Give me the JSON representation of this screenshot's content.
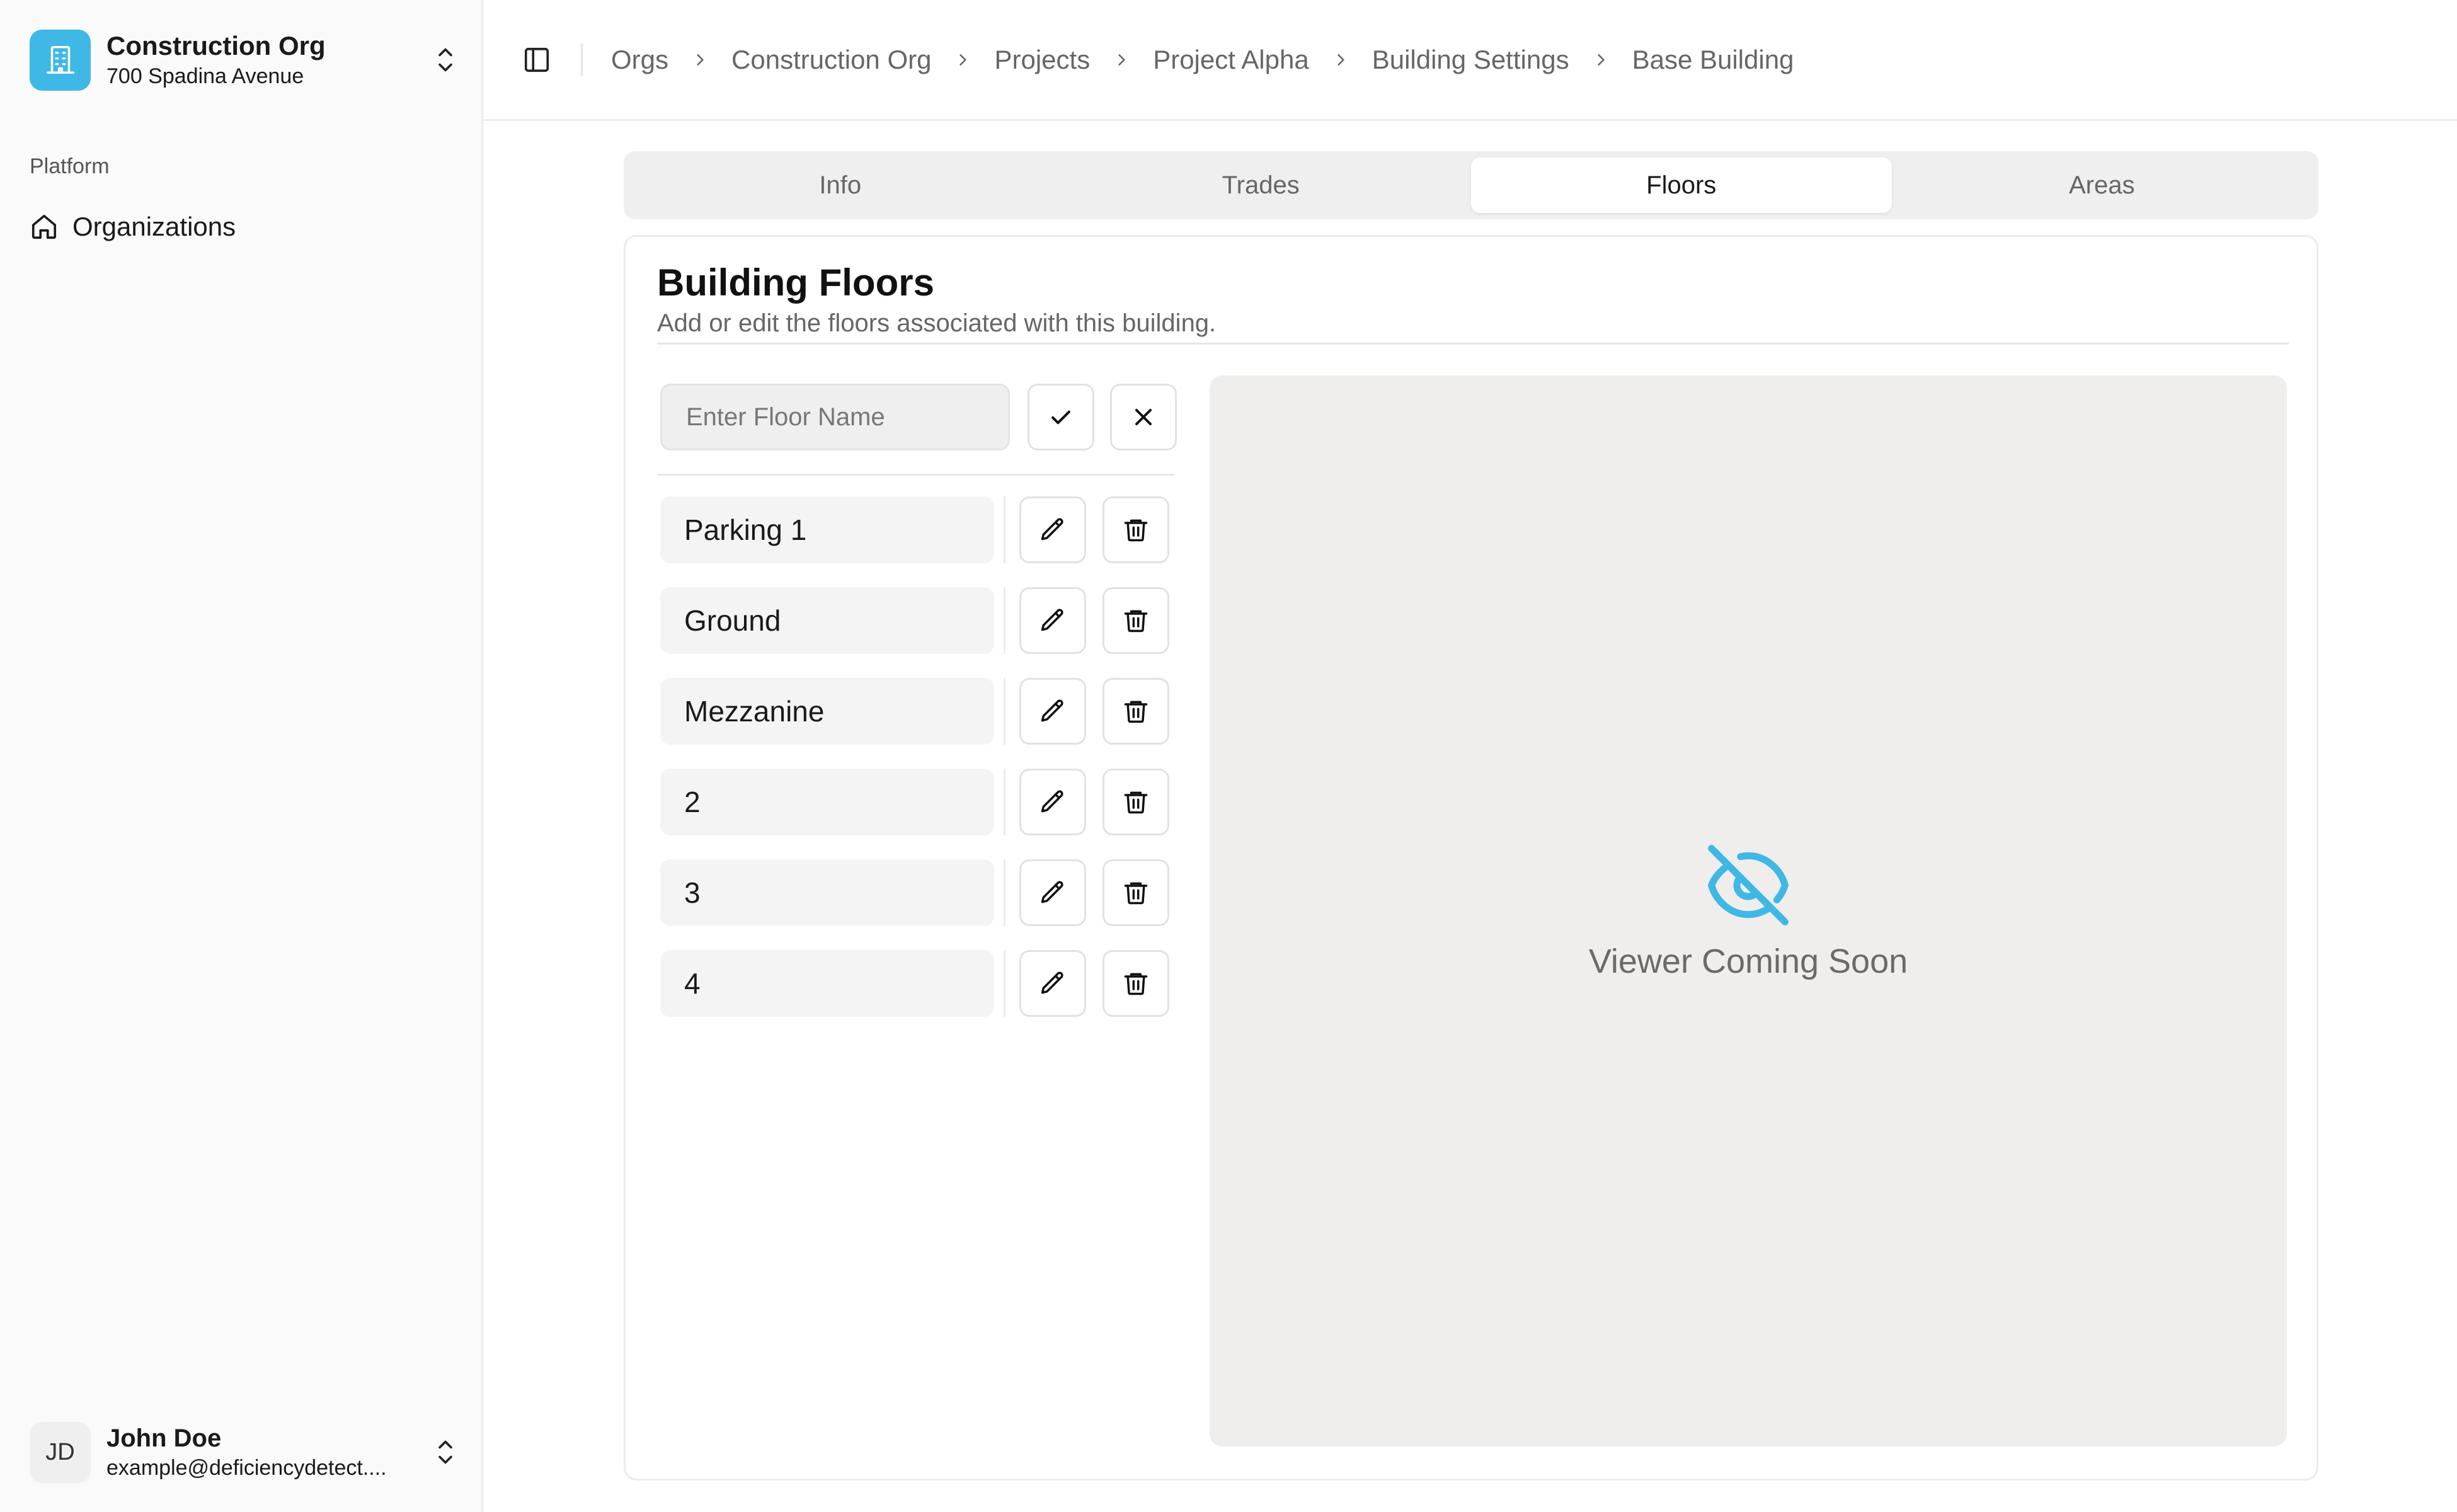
{
  "org": {
    "name": "Construction Org",
    "address": "700 Spadina Avenue",
    "accent": "#3fb8e6"
  },
  "sidebar": {
    "section_label": "Platform",
    "items": [
      {
        "label": "Organizations",
        "icon": "home-icon"
      }
    ]
  },
  "user": {
    "initials": "JD",
    "name": "John Doe",
    "email": "example@deficiencydetect...."
  },
  "breadcrumb": [
    "Orgs",
    "Construction Org",
    "Projects",
    "Project Alpha",
    "Building Settings",
    "Base Building"
  ],
  "tabs": [
    {
      "label": "Info",
      "active": false
    },
    {
      "label": "Trades",
      "active": false
    },
    {
      "label": "Floors",
      "active": true
    },
    {
      "label": "Areas",
      "active": false
    }
  ],
  "card": {
    "title": "Building Floors",
    "description": "Add or edit the floors associated with this building."
  },
  "floor_input": {
    "placeholder": "Enter Floor Name",
    "value": ""
  },
  "floors": [
    "Parking 1",
    "Ground",
    "Mezzanine",
    "2",
    "3",
    "4"
  ],
  "viewer": {
    "text": "Viewer Coming Soon",
    "icon": "eye-off-icon"
  }
}
